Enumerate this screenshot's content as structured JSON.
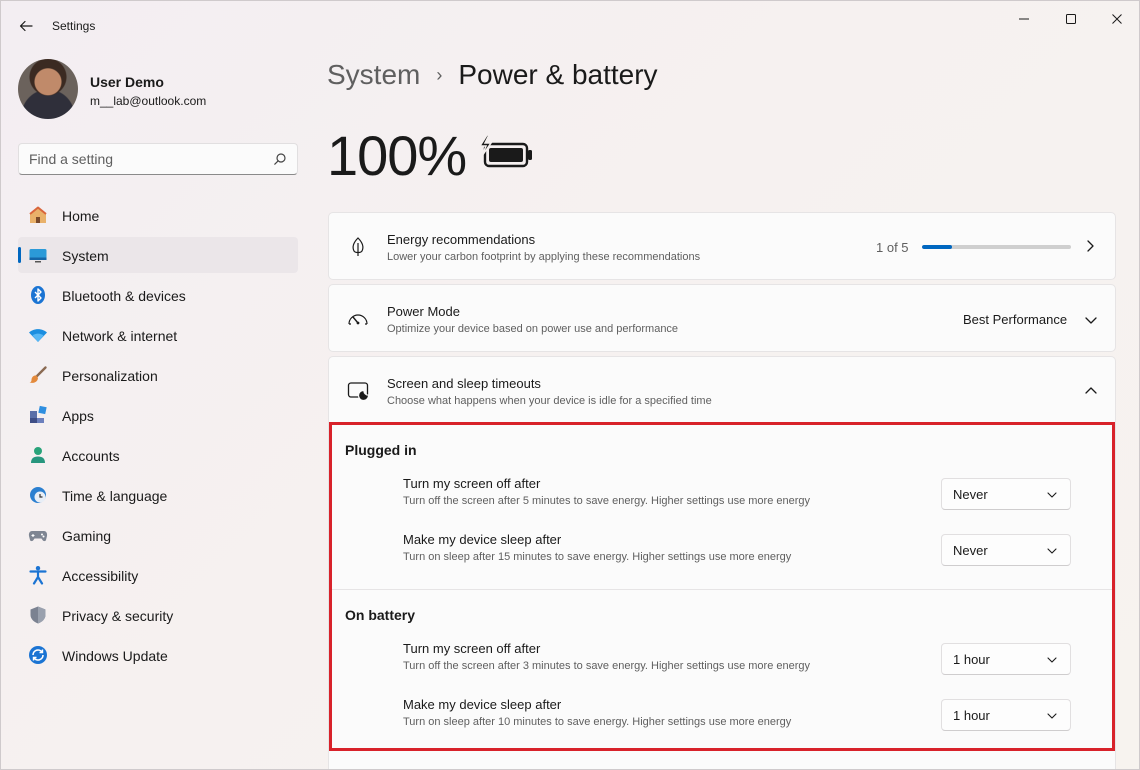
{
  "window": {
    "title": "Settings",
    "back_label": "←",
    "minimize": "minimize",
    "maximize": "maximize",
    "close": "close"
  },
  "user": {
    "name": "User Demo",
    "email": "m__lab@outlook.com"
  },
  "search": {
    "placeholder": "Find a setting"
  },
  "sidebar": {
    "items": [
      {
        "label": "Home",
        "icon": "home-icon",
        "selected": false
      },
      {
        "label": "System",
        "icon": "system-icon",
        "selected": true
      },
      {
        "label": "Bluetooth & devices",
        "icon": "bluetooth-icon",
        "selected": false
      },
      {
        "label": "Network & internet",
        "icon": "wifi-icon",
        "selected": false
      },
      {
        "label": "Personalization",
        "icon": "brush-icon",
        "selected": false
      },
      {
        "label": "Apps",
        "icon": "apps-icon",
        "selected": false
      },
      {
        "label": "Accounts",
        "icon": "accounts-icon",
        "selected": false
      },
      {
        "label": "Time & language",
        "icon": "time-language-icon",
        "selected": false
      },
      {
        "label": "Gaming",
        "icon": "gamepad-icon",
        "selected": false
      },
      {
        "label": "Accessibility",
        "icon": "accessibility-icon",
        "selected": false
      },
      {
        "label": "Privacy & security",
        "icon": "shield-icon",
        "selected": false
      },
      {
        "label": "Windows Update",
        "icon": "update-icon",
        "selected": false
      }
    ]
  },
  "main": {
    "breadcrumb_parent": "System",
    "breadcrumb_sep": "›",
    "breadcrumb_current": "Power & battery",
    "battery_percent": "100%",
    "energy": {
      "title": "Energy recommendations",
      "subtitle": "Lower your carbon footprint by applying these recommendations",
      "pager": "1 of 5",
      "progress": 0.2
    },
    "power_mode": {
      "title": "Power Mode",
      "subtitle": "Optimize your device based on power use and performance",
      "value": "Best Performance"
    },
    "screen_sleep": {
      "title": "Screen and sleep timeouts",
      "subtitle": "Choose what happens when your device is idle for a specified time",
      "groups": [
        {
          "title": "Plugged in",
          "rows": [
            {
              "title": "Turn my screen off after",
              "subtitle": "Turn off the screen after 5 minutes to save energy. Higher settings use more energy",
              "value": "Never"
            },
            {
              "title": "Make my device sleep after",
              "subtitle": "Turn on sleep after 15 minutes to save energy. Higher settings use more energy",
              "value": "Never"
            }
          ]
        },
        {
          "title": "On battery",
          "rows": [
            {
              "title": "Turn my screen off after",
              "subtitle": "Turn off the screen after 3 minutes to save energy. Higher settings use more energy",
              "value": "1 hour"
            },
            {
              "title": "Make my device sleep after",
              "subtitle": "Turn on sleep after 10 minutes to save energy. Higher settings use more energy",
              "value": "1 hour"
            }
          ]
        }
      ]
    }
  },
  "colors": {
    "accent": "#0067c0",
    "highlight": "#d8222a"
  }
}
